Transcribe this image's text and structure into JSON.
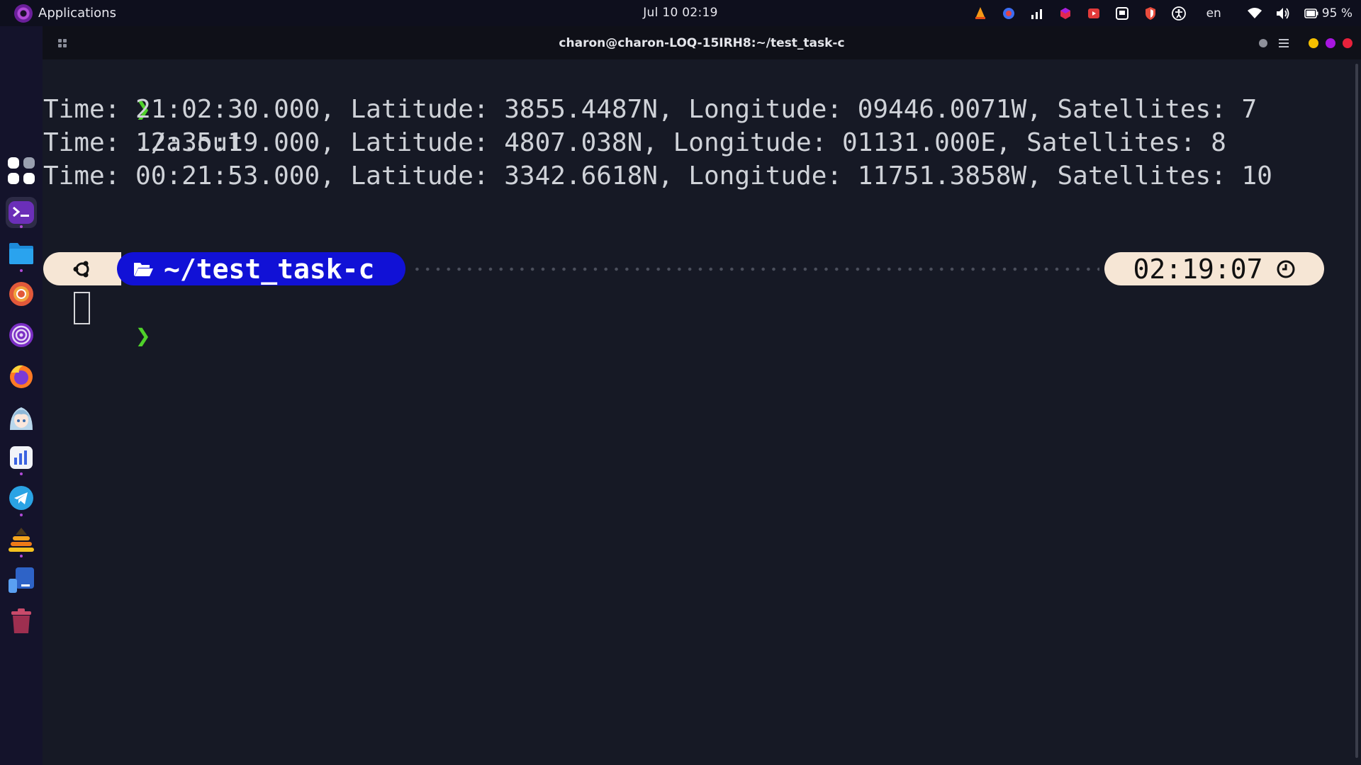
{
  "topbar": {
    "apps_label": "Applications",
    "clock": "Jul 10  02:19",
    "lang": "en",
    "battery": "95 %"
  },
  "window": {
    "title": "charon@charon-LOQ-15IRH8:~/test_task-c"
  },
  "terminal": {
    "prompt_symbol": "❯",
    "command": "./a.out",
    "output": [
      "Time: 21:02:30.000, Latitude: 3855.4487N, Longitude: 09446.0071W, Satellites: 7",
      "Time: 12:35:19.000, Latitude: 4807.038N, Longitude: 01131.000E, Satellites: 8",
      "Time: 00:21:53.000, Latitude: 3342.6618N, Longitude: 11751.3858W, Satellites: 10"
    ],
    "powerline": {
      "directory": "~/test_task-c",
      "time": "02:19:07"
    }
  },
  "colors": {
    "accent": "#b04ad8",
    "prompt_green": "#4fd12a",
    "dir_segment": "#1111d6",
    "segment_light": "#f6e6d5"
  },
  "dock": {
    "items": [
      "app-grid-icon",
      "terminal-icon",
      "files-icon",
      "chrome-icon",
      "tor-icon",
      "firefox-icon",
      "anime-avatar-icon",
      "analytics-icon",
      "telegram-icon",
      "layers-icon",
      "desktop-icon",
      "trash-icon"
    ]
  }
}
